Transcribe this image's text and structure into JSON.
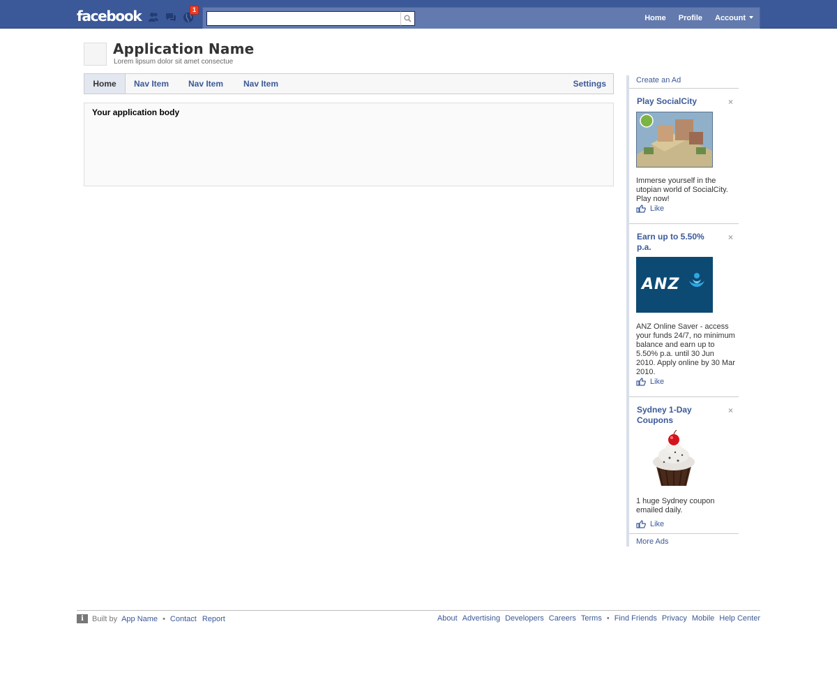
{
  "topbar": {
    "logo": "facebook",
    "notifications_count": "1",
    "search": {
      "value": "",
      "placeholder": ""
    },
    "nav": {
      "home": "Home",
      "profile": "Profile",
      "account": "Account"
    }
  },
  "app": {
    "name": "Application Name",
    "tagline": "Lorem lipsum dolor sit amet consectue"
  },
  "tabs": {
    "items": [
      "Home",
      "Nav Item",
      "Nav Item",
      "Nav Item"
    ],
    "settings": "Settings"
  },
  "body": {
    "text": "Your application body"
  },
  "ads": {
    "create": "Create an Ad",
    "items": [
      {
        "title": "Play SocialCity",
        "text": "Immerse yourself in the utopian world of SocialCity. Play now!",
        "like": "Like"
      },
      {
        "title": "Earn up to 5.50% p.a.",
        "text": "ANZ Online Saver - access your funds 24/7, no minimum balance and earn up to 5.50% p.a. until 30 Jun 2010. Apply online by 30 Mar 2010.",
        "like": "Like",
        "logo_text": "ANZ"
      },
      {
        "title": "Sydney 1-Day Coupons",
        "text": "1 huge Sydney coupon emailed daily.",
        "like": "Like"
      }
    ],
    "close_glyph": "×",
    "more": "More Ads"
  },
  "footer": {
    "built_by": "Built by",
    "app_name": "App Name",
    "contact": "Contact",
    "report": "Report",
    "links_a": [
      "About",
      "Advertising",
      "Developers",
      "Careers",
      "Terms"
    ],
    "links_b": [
      "Find Friends",
      "Privacy",
      "Mobile",
      "Help Center"
    ]
  },
  "colors": {
    "brand": "#3b5998",
    "brand_light": "#627aad",
    "badge": "#f03d25"
  }
}
